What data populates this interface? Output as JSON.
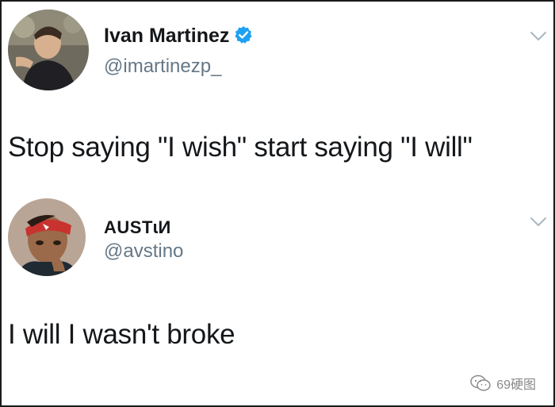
{
  "tweets": [
    {
      "display_name": "Ivan Martinez",
      "handle": "@imartinezp_",
      "verified": true,
      "text": "Stop saying \"I wish\" start saying \"I will\"",
      "avatar_icon": "person-avatar"
    },
    {
      "display_name": "AUSTɩИ",
      "handle": "@avstino",
      "verified": false,
      "text": "I will I wasn't broke",
      "avatar_icon": "person-avatar"
    }
  ],
  "watermark": {
    "text": "69硬图",
    "icon": "wechat-icon"
  },
  "colors": {
    "verified_blue": "#1da1f2",
    "handle_gray": "#657786",
    "chevron_gray": "#aab8c2"
  }
}
